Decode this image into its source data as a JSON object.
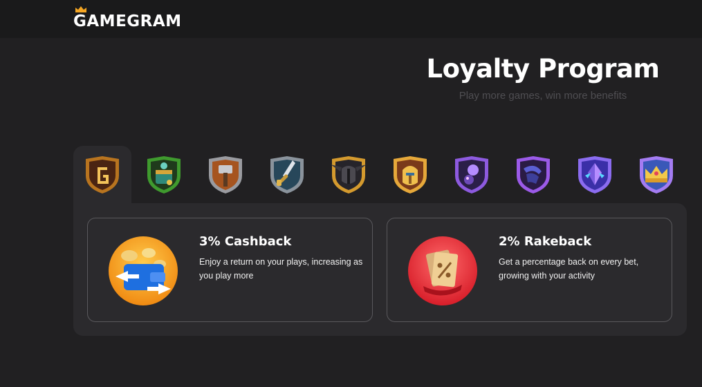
{
  "brand": {
    "name": "GAMEGRAM",
    "crown_icon": "crown-icon",
    "accent": "#f5a623"
  },
  "hero": {
    "title": "Loyalty Program",
    "subtitle": "Play more games, win more benefits"
  },
  "tiers": [
    {
      "icon": "tier-g-badge-icon",
      "active": true
    },
    {
      "icon": "tier-green-chest-icon",
      "active": false
    },
    {
      "icon": "tier-hammer-badge-icon",
      "active": false
    },
    {
      "icon": "tier-sword-badge-icon",
      "active": false
    },
    {
      "icon": "tier-dark-helmet-icon",
      "active": false
    },
    {
      "icon": "tier-golden-helmet-icon",
      "active": false
    },
    {
      "icon": "tier-purple-orb-icon",
      "active": false
    },
    {
      "icon": "tier-purple-horn-icon",
      "active": false
    },
    {
      "icon": "tier-crystal-icon",
      "active": false
    },
    {
      "icon": "tier-crown-badge-icon",
      "active": false
    }
  ],
  "benefits": [
    {
      "title": "3% Cashback",
      "description": "Enjoy a return on your plays, increasing as you play more",
      "icon": "cashback-wallet-icon"
    },
    {
      "title": "2% Rakeback",
      "description": "Get a percentage back on every bet, growing with your activity",
      "icon": "rakeback-percent-icon"
    }
  ]
}
